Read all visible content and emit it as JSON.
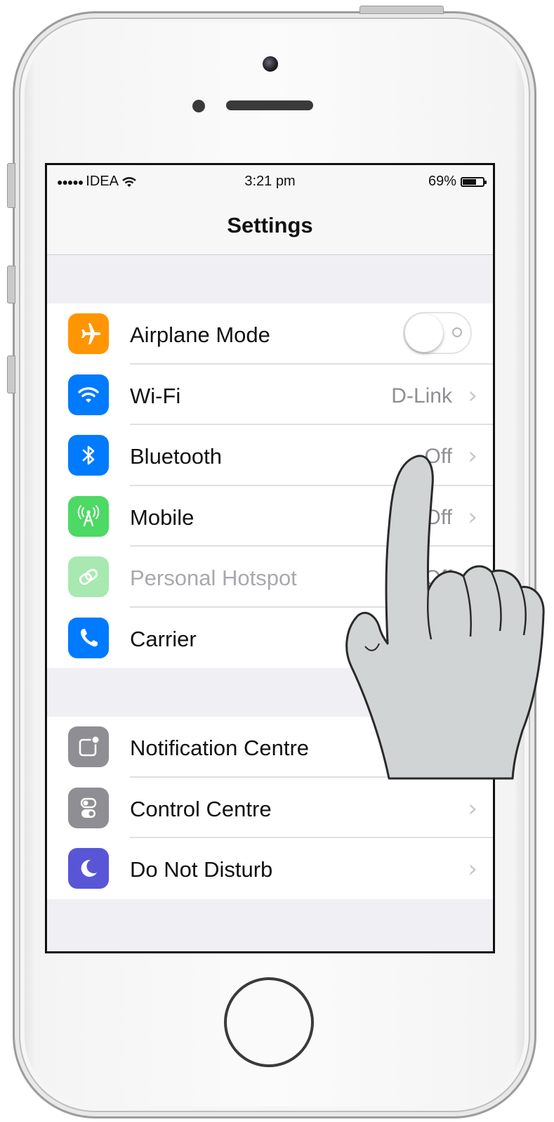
{
  "status_bar": {
    "signal": "●●●●●",
    "carrier": "IDEA",
    "wifi_icon": "wifi-icon",
    "time": "3:21 pm",
    "battery_text": "69%",
    "battery_level": 0.69
  },
  "nav": {
    "title": "Settings"
  },
  "group1": [
    {
      "label": "Airplane Mode",
      "icon": "airplane-icon",
      "color": "#ff9500",
      "control": "toggle",
      "toggle_on": false
    },
    {
      "label": "Wi-Fi",
      "icon": "wifi-icon",
      "color": "#007aff",
      "value": "D-Link",
      "control": "chevron"
    },
    {
      "label": "Bluetooth",
      "icon": "bluetooth-icon",
      "color": "#007aff",
      "value": "Off",
      "control": "chevron"
    },
    {
      "label": "Mobile",
      "icon": "antenna-icon",
      "color": "#4cd964",
      "value": "Off",
      "control": "chevron"
    },
    {
      "label": "Personal Hotspot",
      "icon": "hotspot-icon",
      "color": "#a7e9b0",
      "value": "Off",
      "control": "chevron",
      "disabled": true
    },
    {
      "label": "Carrier",
      "icon": "phone-icon",
      "color": "#007aff",
      "control": "chevron"
    }
  ],
  "group2": [
    {
      "label": "Notification Centre",
      "icon": "notification-centre-icon",
      "color": "#8e8e93",
      "control": "chevron"
    },
    {
      "label": "Control Centre",
      "icon": "control-centre-icon",
      "color": "#8e8e93",
      "control": "chevron"
    },
    {
      "label": "Do Not Disturb",
      "icon": "moon-icon",
      "color": "#5856d6",
      "control": "chevron"
    }
  ],
  "chevron_glyph": "›"
}
